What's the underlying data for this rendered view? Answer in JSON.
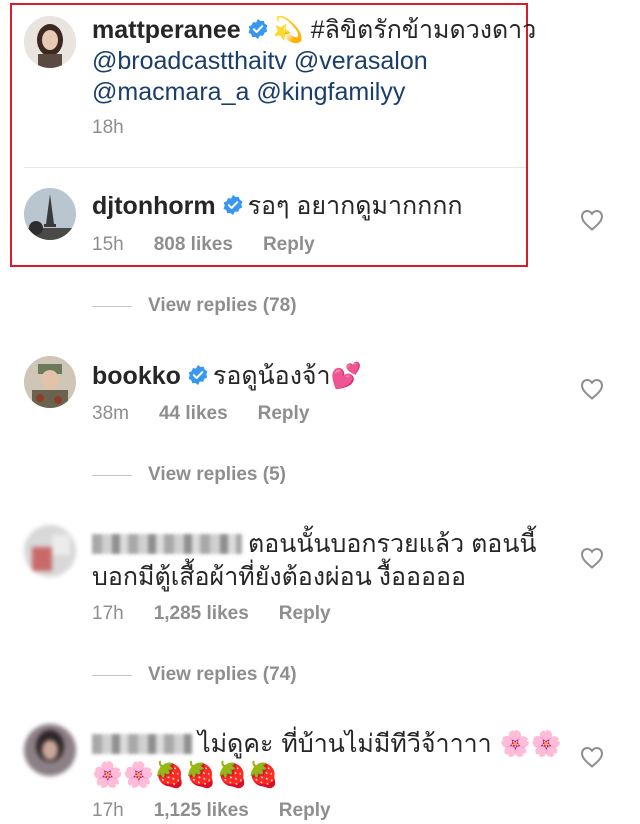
{
  "post_caption": {
    "username": "mattperanee",
    "text": "💫 #ลิขิตรักข้ามดวงดาว",
    "mentions_line2": "@broadcastthaitv @verasalon",
    "mentions_line3": "@macmara_a @kingfamilyy",
    "time": "18h"
  },
  "comments": [
    {
      "username": "djtonhorm",
      "text": "รอๆ อยากดูมากกกก",
      "time": "15h",
      "likes": "808 likes",
      "reply": "Reply",
      "view_replies": "View replies (78)"
    },
    {
      "username": "bookko",
      "text": "รอดูน้องจ้า💕",
      "time": "38m",
      "likes": "44 likes",
      "reply": "Reply",
      "view_replies": "View replies (5)"
    },
    {
      "username": "",
      "text_line1": "ตอนนั้นบอกรวยแล้ว ตอนนี้",
      "text_line2": "บอกมีตู้เสื้อผ้าที่ยังต้องผ่อน งื้อออออ",
      "time": "17h",
      "likes": "1,285 likes",
      "reply": "Reply",
      "view_replies": "View replies (74)"
    },
    {
      "username": "",
      "text_line1": "ไม่ดูคะ  ที่บ้านไม่มีทีวีจ้าาาา 🌸🌸",
      "text_line2": "🌸🌸🍓🍓🍓🍓",
      "time": "17h",
      "likes": "1,125 likes",
      "reply": "Reply"
    }
  ],
  "colors": {
    "highlight": "#d91c2a",
    "verified": "#3897f0",
    "meta": "#8e8e8e"
  },
  "icons": [
    "verified-badge-icon",
    "heart-icon"
  ]
}
